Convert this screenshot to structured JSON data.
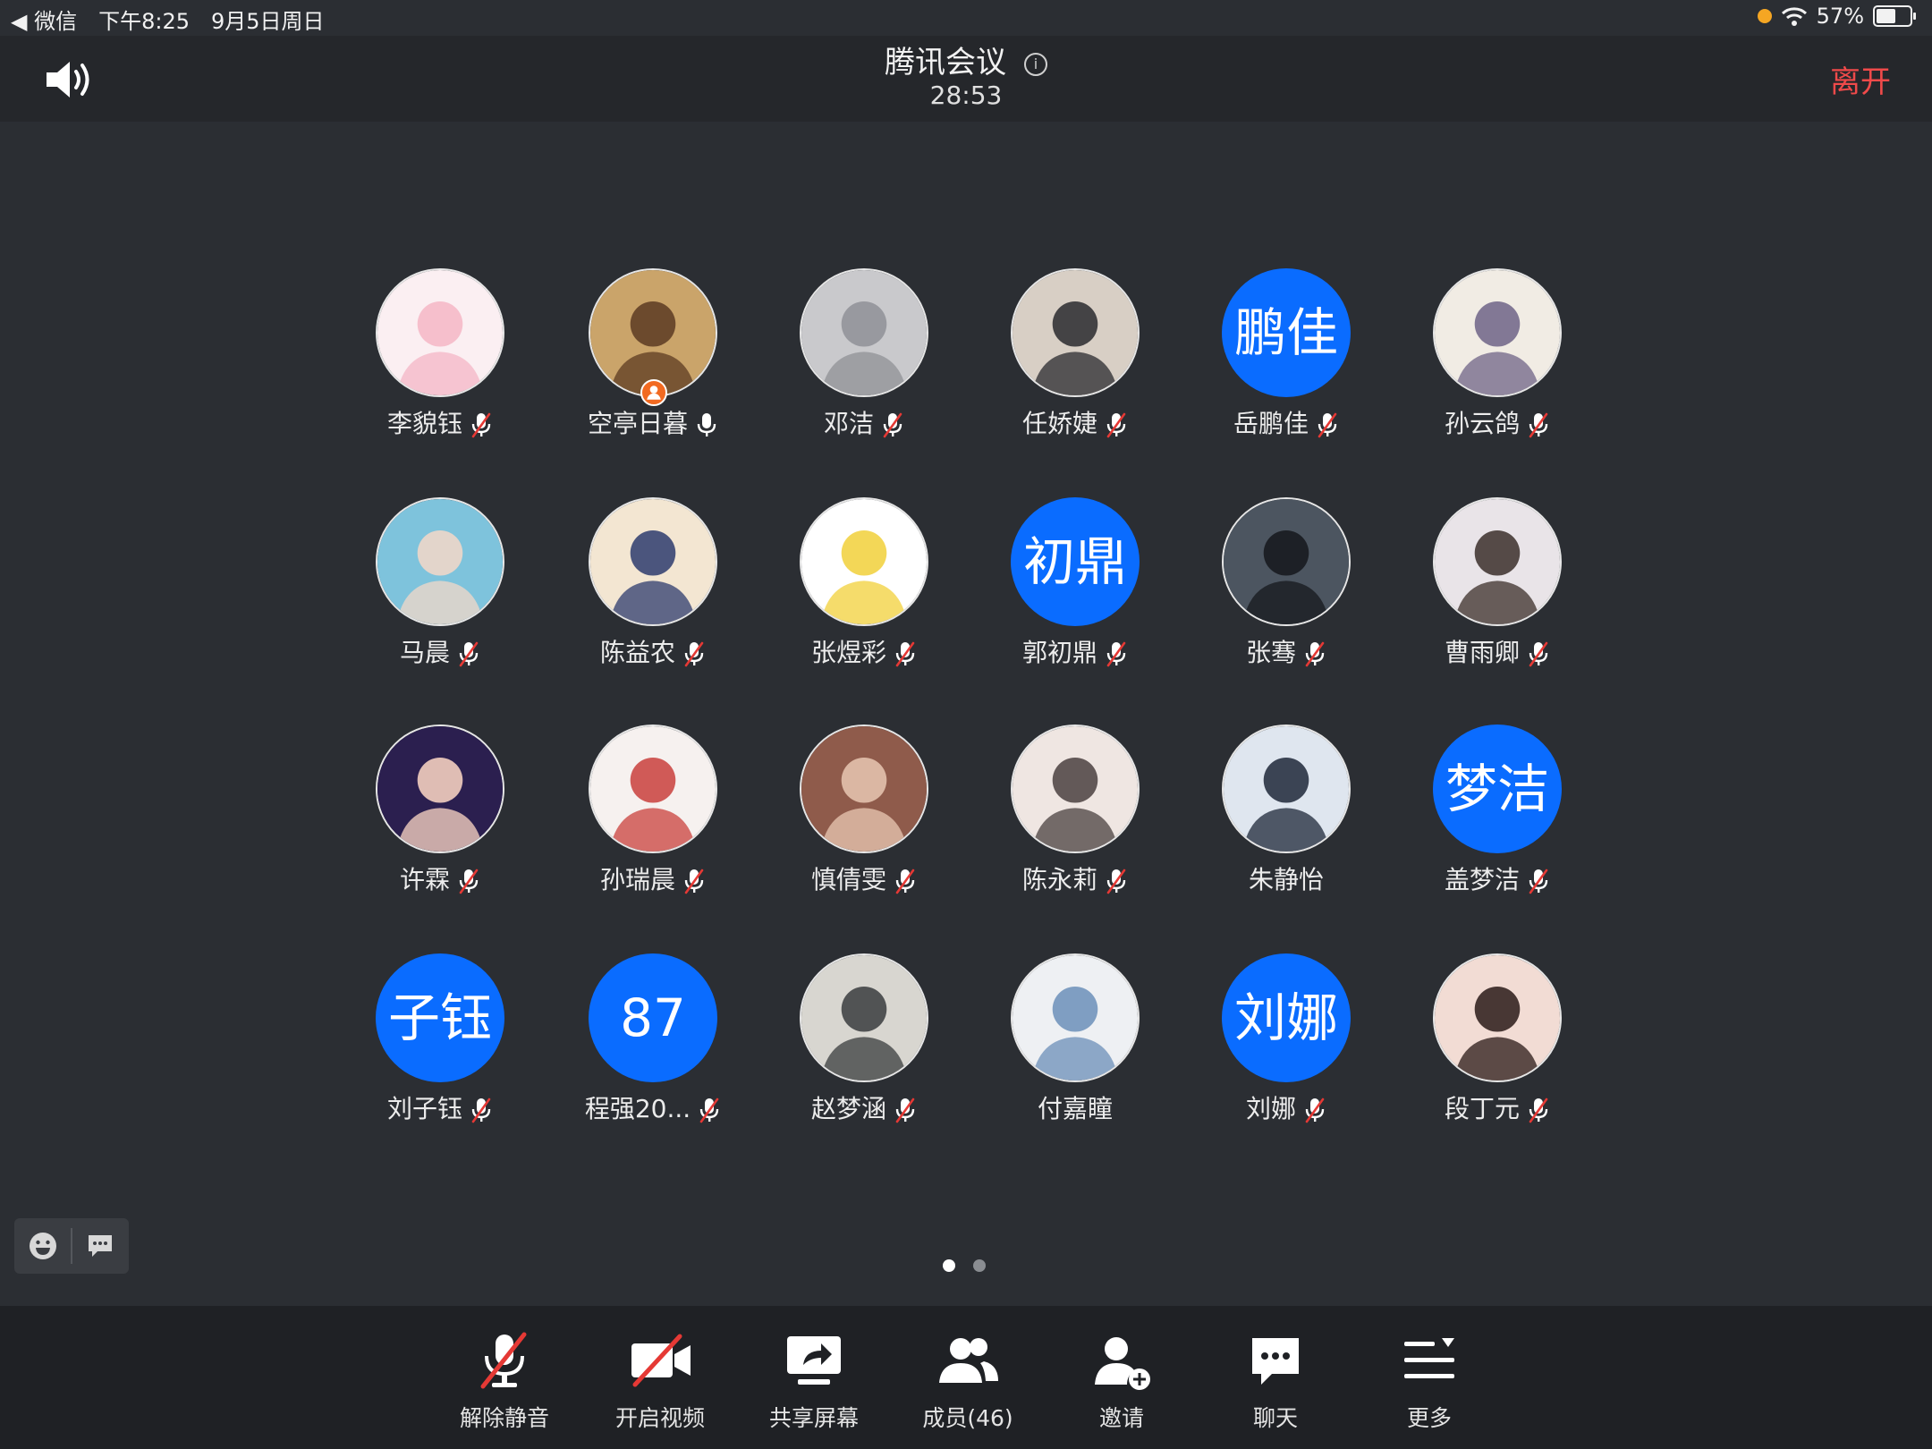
{
  "status_bar": {
    "back_app": "◀ 微信",
    "time": "下午8:25",
    "date": "9月5日周日",
    "battery": "57%",
    "battery_level": 0.57
  },
  "header": {
    "title": "腾讯会议",
    "timer": "28:53",
    "leave_label": "离开"
  },
  "participants": [
    {
      "name": "李貌钰",
      "mic": "muted",
      "avatar": "photo",
      "palette": [
        "#fbeff2",
        "#f4b6c6"
      ]
    },
    {
      "name": "空亭日暮",
      "mic": "on",
      "avatar": "photo",
      "palette": [
        "#caa46a",
        "#5c3b22"
      ],
      "host": true
    },
    {
      "name": "邓洁",
      "mic": "muted",
      "avatar": "photo",
      "palette": [
        "#c9c9cc",
        "#8f9096"
      ]
    },
    {
      "name": "任娇婕",
      "mic": "muted",
      "avatar": "photo",
      "palette": [
        "#d8cfc5",
        "#2a2a2e"
      ]
    },
    {
      "name": "岳鹏佳",
      "mic": "muted",
      "avatar": "text",
      "initials": "鹏佳"
    },
    {
      "name": "孙云鸽",
      "mic": "muted",
      "avatar": "photo",
      "palette": [
        "#f1ece4",
        "#6f6487"
      ]
    },
    {
      "name": "马晨",
      "mic": "muted",
      "avatar": "photo",
      "palette": [
        "#7ec3dc",
        "#f4d8c8"
      ]
    },
    {
      "name": "陈益农",
      "mic": "muted",
      "avatar": "photo",
      "palette": [
        "#f3e6d2",
        "#2d3b6e"
      ]
    },
    {
      "name": "张煜彩",
      "mic": "muted",
      "avatar": "photo",
      "palette": [
        "#ffffff",
        "#f1d03a"
      ]
    },
    {
      "name": "郭初鼎",
      "mic": "muted",
      "avatar": "text",
      "initials": "初鼎"
    },
    {
      "name": "张骞",
      "mic": "muted",
      "avatar": "photo",
      "palette": [
        "#4c5560",
        "#15181c"
      ]
    },
    {
      "name": "曹雨卿",
      "mic": "muted",
      "avatar": "photo",
      "palette": [
        "#e9e4e8",
        "#3b2f2a"
      ]
    },
    {
      "name": "许霖",
      "mic": "muted",
      "avatar": "photo",
      "palette": [
        "#2b1f4f",
        "#ffd9c5"
      ]
    },
    {
      "name": "孙瑞晨",
      "mic": "muted",
      "avatar": "photo",
      "palette": [
        "#f6f1ef",
        "#c9403c"
      ]
    },
    {
      "name": "慎倩雯",
      "mic": "muted",
      "avatar": "photo",
      "palette": [
        "#8f5b4b",
        "#e9c8b3"
      ]
    },
    {
      "name": "陈永莉",
      "mic": "muted",
      "avatar": "photo",
      "palette": [
        "#efe6e2",
        "#4a403f"
      ]
    },
    {
      "name": "朱静怡",
      "mic": "none",
      "avatar": "photo",
      "palette": [
        "#dfe6ef",
        "#1e2738"
      ]
    },
    {
      "name": "盖梦洁",
      "mic": "muted",
      "avatar": "text",
      "initials": "梦洁"
    },
    {
      "name": "刘子钰",
      "mic": "muted",
      "avatar": "text",
      "initials": "子钰"
    },
    {
      "name": "程强20...",
      "mic": "muted",
      "avatar": "text",
      "initials": "87"
    },
    {
      "name": "赵梦涵",
      "mic": "muted",
      "avatar": "photo",
      "palette": [
        "#d8d6d0",
        "#3a3c3e"
      ]
    },
    {
      "name": "付嘉瞳",
      "mic": "none",
      "avatar": "photo",
      "palette": [
        "#eef0f3",
        "#6b8fb8"
      ]
    },
    {
      "name": "刘娜",
      "mic": "muted",
      "avatar": "text",
      "initials": "刘娜"
    },
    {
      "name": "段丁元",
      "mic": "muted",
      "avatar": "photo",
      "palette": [
        "#f2dcd4",
        "#2a1a17"
      ]
    }
  ],
  "pager": {
    "pages": 2,
    "current": 1
  },
  "toolbar": [
    {
      "label": "解除静音",
      "icon": "mic-muted-icon"
    },
    {
      "label": "开启视频",
      "icon": "video-off-icon"
    },
    {
      "label": "共享屏幕",
      "icon": "share-screen-icon"
    },
    {
      "label": "成员(46)",
      "icon": "members-icon"
    },
    {
      "label": "邀请",
      "icon": "invite-icon"
    },
    {
      "label": "聊天",
      "icon": "chat-icon"
    },
    {
      "label": "更多",
      "icon": "more-icon"
    }
  ],
  "colors": {
    "accent": "#0a6cff",
    "leave": "#f04a4a",
    "muted_slash": "#e53935",
    "bg": "#2b2e33",
    "bar": "#1f2125"
  }
}
